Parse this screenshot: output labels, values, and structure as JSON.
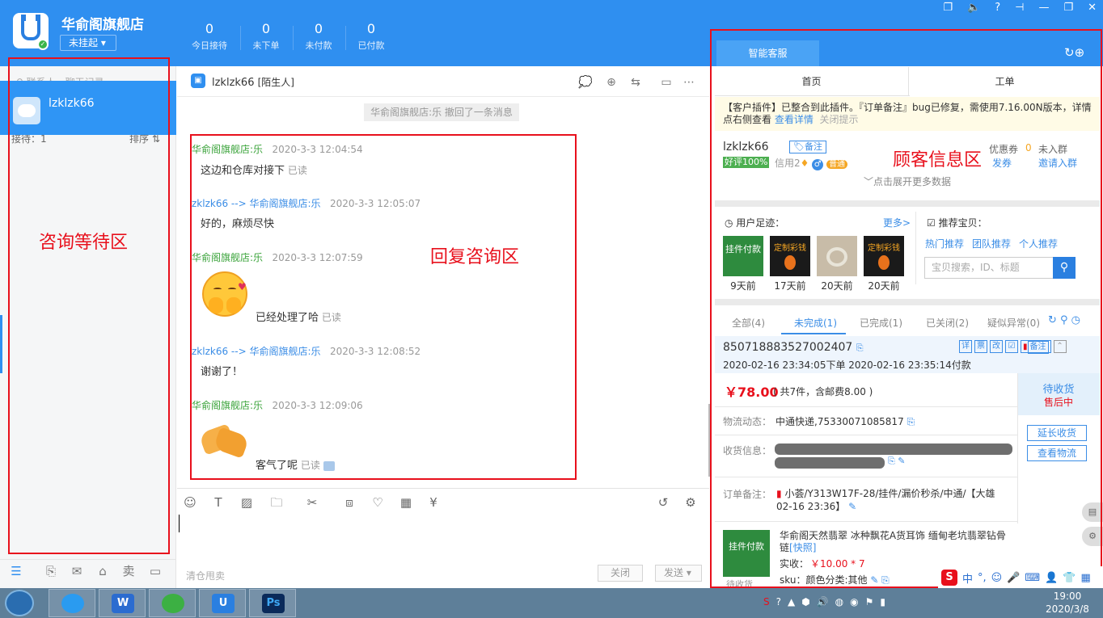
{
  "header": {
    "shop_name": "华俞阁旗舰店",
    "status": "未挂起 ▾",
    "stats": [
      {
        "num": "0",
        "label": "今日接待"
      },
      {
        "num": "0",
        "label": "未下单"
      },
      {
        "num": "0",
        "label": "未付款"
      },
      {
        "num": "0",
        "label": "已付款"
      }
    ],
    "window_icons": [
      "❐",
      "🔈",
      "?",
      "⊣",
      "—",
      "❐",
      "✕"
    ]
  },
  "left": {
    "search_placeholder": "联系人、聊天记录",
    "reception": "接待：1",
    "sort": "排序 ⇅",
    "contact_name": "lzklzk66",
    "annotation": "咨询等待区"
  },
  "chat": {
    "title": "lzklzk66",
    "title_tag": "[陌生人]",
    "recall_notice": "华俞阁旗舰店:乐 撤回了一条消息",
    "annotation": "回复咨询区",
    "messages": [
      {
        "sender": "华俞阁旗舰店:乐",
        "time": "2020-3-3 12:04:54",
        "text": "这边和仓库对接下",
        "read": "已读"
      },
      {
        "sender": "zklzk66 --> 华俞阁旗舰店:乐",
        "time": "2020-3-3 12:05:07",
        "text": "好的，麻烦尽快",
        "read": ""
      },
      {
        "sender": "华俞阁旗舰店:乐",
        "time": "2020-3-3 12:07:59",
        "text": "已经处理了哈",
        "read": "已读"
      },
      {
        "sender": "zklzk66 --> 华俞阁旗舰店:乐",
        "time": "2020-3-3 12:08:52",
        "text": "谢谢了！",
        "read": ""
      },
      {
        "sender": "华俞阁旗舰店:乐",
        "time": "2020-3-3 12:09:06",
        "text": "客气了呢",
        "read": "已读"
      }
    ],
    "clear_label": "清仓甩卖",
    "close_label": "关闭",
    "send_label": "发送 ▾"
  },
  "right": {
    "smart_tab": "智能客服",
    "tab_home": "首页",
    "tab_ticket": "工单",
    "notice_text": "【客户插件】已整合到此插件。『订单备注』bug已修复，需使用7.16.00N版本，详情点右侧查看",
    "notice_link": "查看详情",
    "notice_close": "关闭提示",
    "customer_name": "lzklzk66",
    "note_tag": "备注",
    "good_rate": "好评100%",
    "credit": "信用2",
    "level": "普通",
    "coupon": "优惠券",
    "coupon_n": "0",
    "send_coupon": "发券",
    "not_joined": "未入群",
    "invite": "邀请入群",
    "annotation": "顾客信息区",
    "expand": "点击展开更多数据",
    "footprint_title": "用户足迹：",
    "more": "更多>",
    "recommend_title": "推荐宝贝：",
    "footprints": [
      {
        "label": "9天前",
        "img_text": "挂件付款"
      },
      {
        "label": "17天前",
        "img_text": "定制彩钱"
      },
      {
        "label": "20天前",
        "img_text": ""
      },
      {
        "label": "20天前",
        "img_text": "定制彩钱"
      }
    ],
    "rec_links": [
      "热门推荐",
      "团队推荐",
      "个人推荐"
    ],
    "rec_search_placeholder": "宝贝搜索，ID、标题",
    "order_tabs": [
      "全部(4)",
      "未完成(1)",
      "已完成(1)",
      "已关闭(2)",
      "疑似异常(0)"
    ],
    "order_no": "850718883527002407",
    "order_time": "2020-02-16 23:34:05下单  2020-02-16 23:35:14付款",
    "order_icons": [
      "详",
      "票",
      "改",
      "☑",
      "备注"
    ],
    "price": "￥78.00",
    "price_note": "( 共7件，含邮费8.00 )",
    "status_main": "待收货",
    "status_sub": "售后中",
    "btn_extend": "延长收货",
    "btn_logistics": "查看物流",
    "logistics_label": "物流动态：",
    "logistics_value": "中通快递,75330071085817",
    "address_label": "收货信息：",
    "remark_label": "订单备注：",
    "remark_value": "小荟/Y313W17F-28/挂件/漏价秒杀/中通/【大雄",
    "remark_value2": "02-16 23:36】",
    "product_title": "华俞阁天然翡翠 冰种飘花A货耳饰 缅甸老坑翡翠钻骨链",
    "product_link": "[快照]",
    "paid_label": "实收：",
    "paid_value": "￥10.00 * 7",
    "sku": "sku：颜色分类:其他",
    "product_img_text": "挂件付款",
    "product_status": "待收货"
  },
  "ime": [
    "S",
    "中",
    "°,",
    "☺",
    "🎤",
    "⌨",
    "👤",
    "👕",
    "▦"
  ],
  "taskbar": {
    "apps": [
      {
        "text": "",
        "color": "#2a9bf0"
      },
      {
        "text": "W",
        "color": "#2b6cd0"
      },
      {
        "text": "",
        "color": "#3cb043"
      },
      {
        "text": "U",
        "color": "#2a7fe0"
      },
      {
        "text": "Ps",
        "color": "#0a2a5a"
      }
    ],
    "time": "19:00",
    "date": "2020/3/8"
  }
}
